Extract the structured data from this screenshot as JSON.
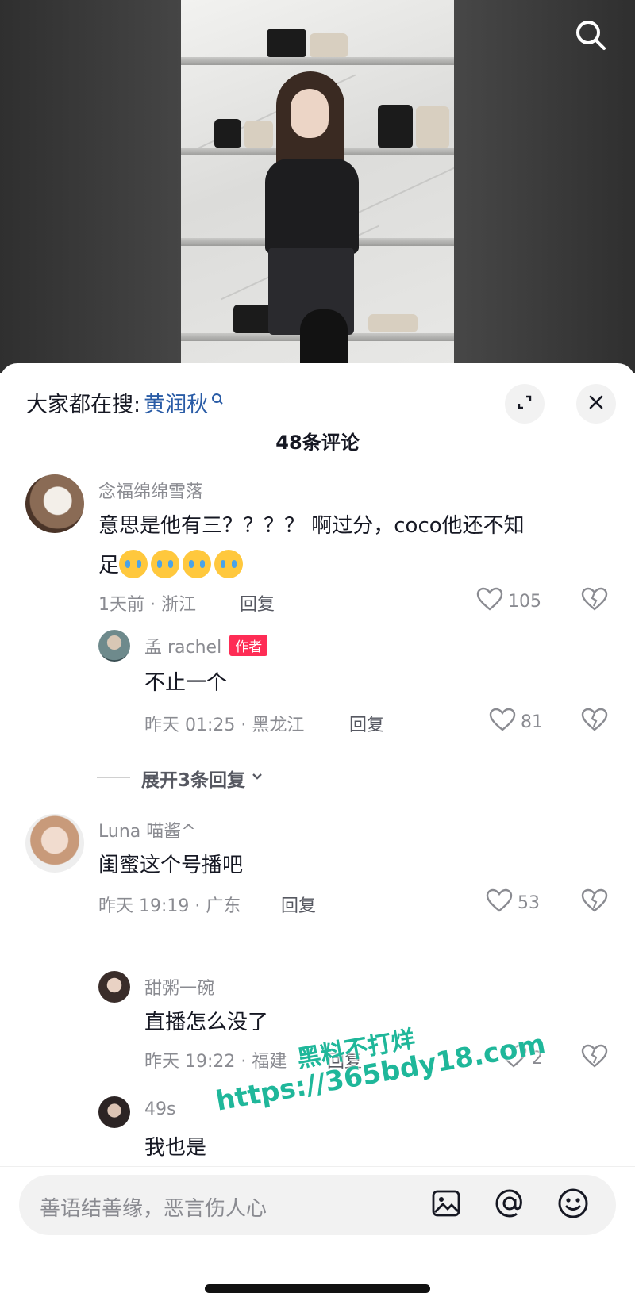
{
  "hot_search": {
    "prefix": "大家都在搜:",
    "keyword": "黄润秋"
  },
  "comment_count": "48条评论",
  "comments": [
    {
      "user": "念福绵绵雪落",
      "text_line1": "意思是他有三？？？？ 啊过分，coco他还不知",
      "text_line2": "足",
      "emoji_count": 4,
      "meta": "1天前 · 浙江",
      "reply_label": "回复",
      "likes": "105",
      "replies": [
        {
          "user": "孟 rachel",
          "tag": "作者",
          "text": "不止一个",
          "meta": "昨天 01:25 · 黑龙江",
          "reply_label": "回复",
          "likes": "81"
        }
      ],
      "expand_label": "展开3条回复"
    },
    {
      "user": "Luna 喵酱^",
      "text": "闺蜜这个号播吧",
      "meta": "昨天 19:19 · 广东",
      "reply_label": "回复",
      "likes": "53",
      "replies": [
        {
          "user": "甜粥一碗",
          "text": "直播怎么没了",
          "meta": "昨天 19:22 · 福建",
          "reply_label": "回复",
          "likes": "2"
        },
        {
          "user": "49s",
          "text": "我也是"
        }
      ]
    }
  ],
  "watermark": {
    "line1": "黑料不打烊",
    "line2": "https://365bdy18.com"
  },
  "input": {
    "placeholder": "善语结善缘，恶言伤人心"
  },
  "colors": {
    "link": "#2a5ca6",
    "author_tag": "#fe2c55",
    "watermark": "#1fb79a"
  },
  "icons": [
    "search-icon",
    "expand-icon",
    "close-icon",
    "heart-icon",
    "dislike-icon",
    "chevron-down-icon",
    "image-icon",
    "at-icon",
    "emoji-icon"
  ]
}
